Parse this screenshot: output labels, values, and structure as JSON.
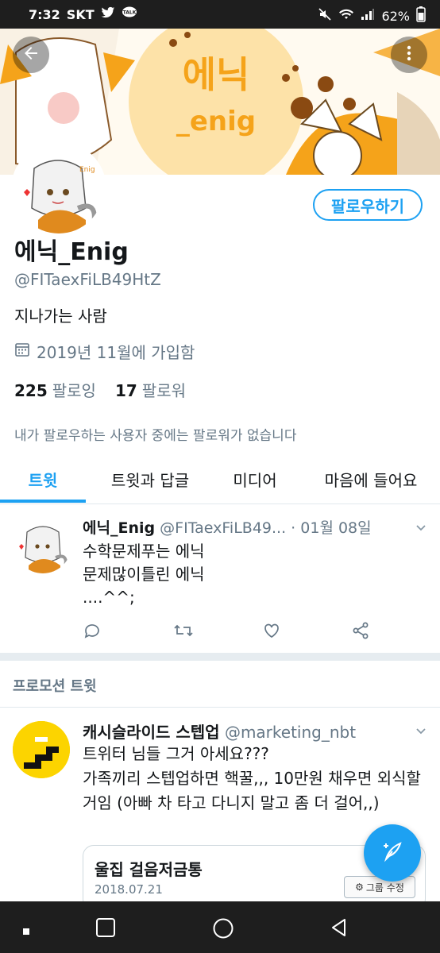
{
  "status_bar": {
    "time": "7:32",
    "carrier": "SKT",
    "battery": "62%"
  },
  "profile": {
    "name": "에닉_Enig",
    "handle": "@FITaexFiLB49HtZ",
    "bio": "지나가는 사람",
    "joined": "2019년 11월에 가입함",
    "following_count": "225",
    "following_label": "팔로잉",
    "followers_count": "17",
    "followers_label": "팔로워",
    "follow_button": "팔로우하기",
    "no_followers_note": "내가 팔로우하는 사용자 중에는 팔로워가 없습니다",
    "banner_text_top": "에닉",
    "banner_text_bottom": "_enig",
    "avatar_tag": "Enig"
  },
  "tabs": [
    {
      "label": "트윗",
      "active": true
    },
    {
      "label": "트윗과 답글",
      "active": false
    },
    {
      "label": "미디어",
      "active": false
    },
    {
      "label": "마음에 들어요",
      "active": false
    }
  ],
  "tweet": {
    "name": "에닉_Enig",
    "handle": "@FITaexFiLB49...",
    "separator": "·",
    "date": "01월 08일",
    "text": "수학문제푸는 에닉\n문제많이틀린 에닉\n....^^;"
  },
  "promo": {
    "section_label": "프로모션 트윗",
    "name": "캐시슬라이드 스텝업",
    "handle": "@marketing_nbt",
    "text": "트위터 님들 그거 아세요???\n가족끼리 스텝업하면 핵꿀,,, 10만원 채우면 외식할 거임 (아빠 차 타고 다니지 말고 좀 더 걸어,,)",
    "card_title": "울집 걸음저금통",
    "card_date": "2018.07.21",
    "card_button": "그룹 수정"
  },
  "colors": {
    "accent": "#1da1f2",
    "text_primary": "#14171a",
    "text_secondary": "#657786",
    "banner_orange": "#f5a31a",
    "promo_yellow": "#fcd400"
  },
  "icons": {
    "back": "arrow-left-icon",
    "more": "more-vertical-icon",
    "calendar": "calendar-icon",
    "reply": "reply-icon",
    "retweet": "retweet-icon",
    "like": "heart-icon",
    "share": "share-icon",
    "compose": "compose-feather-icon"
  }
}
